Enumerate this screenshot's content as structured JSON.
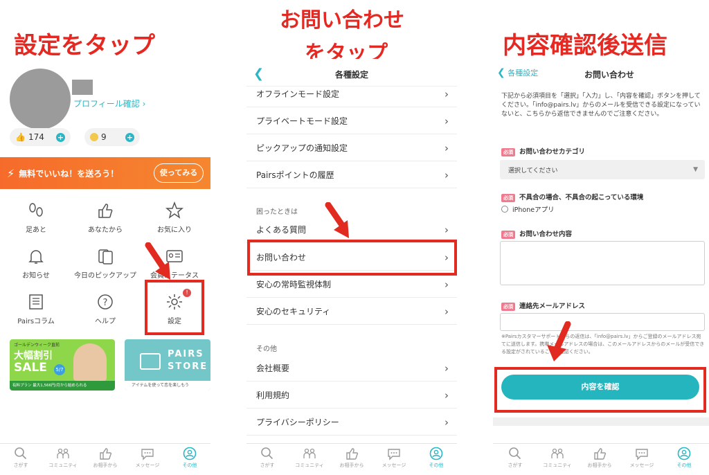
{
  "captions": {
    "step1": "設定をタップ",
    "step2_line1": "お問い合わせ",
    "step2_line2": "をタップ",
    "step3": "内容確認後送信"
  },
  "accent_color": "#29b6c5",
  "highlight_color": "#e12a20",
  "panel1": {
    "profile_link": "プロフィール確認",
    "likes_count": "174",
    "points_count": "9",
    "promo_text": "無料でいいね！を送ろう！",
    "promo_button": "使ってみる",
    "menu": [
      {
        "label": "足あと",
        "icon": "footprints-icon"
      },
      {
        "label": "あなたから",
        "icon": "like-hand-icon"
      },
      {
        "label": "お気に入り",
        "icon": "star-icon"
      },
      {
        "label": "お知らせ",
        "icon": "bell-icon"
      },
      {
        "label": "今日のピックアップ",
        "icon": "cards-icon"
      },
      {
        "label": "会員ステータス",
        "icon": "id-card-icon"
      },
      {
        "label": "Pairsコラム",
        "icon": "newspaper-icon"
      },
      {
        "label": "ヘルプ",
        "icon": "help-icon"
      },
      {
        "label": "設定",
        "icon": "gear-icon"
      }
    ],
    "settings_badge": "!",
    "banner1": {
      "tag": "ゴールデンウィーク直前",
      "title1": "大幅割引",
      "title2": "SALE",
      "date": "5/7",
      "footer": "有料プラン 最大1,566円/月から始められる"
    },
    "banner2": {
      "title1": "PAIRS",
      "title2": "STORE",
      "footer": "アイテムを使って恋を楽しもう"
    }
  },
  "tabbar": [
    {
      "label": "さがす",
      "icon": "search-icon"
    },
    {
      "label": "コミュニティ",
      "icon": "community-icon"
    },
    {
      "label": "お相手から",
      "icon": "thumbs-up-icon"
    },
    {
      "label": "メッセージ",
      "icon": "message-icon"
    },
    {
      "label": "その他",
      "icon": "person-icon"
    }
  ],
  "panel2": {
    "title": "各種設定",
    "rows_top": [
      "オフラインモード設定",
      "プライベートモード設定",
      "ピックアップの通知設定",
      "Pairsポイントの履歴"
    ],
    "section_trouble": "困ったときは",
    "rows_trouble": [
      "よくある質問",
      "お問い合わせ",
      "安心の常時監視体制",
      "安心のセキュリティ"
    ],
    "section_other": "その他",
    "rows_other": [
      "会社概要",
      "利用規約",
      "プライバシーポリシー"
    ]
  },
  "panel3": {
    "back": "各種設定",
    "title": "お問い合わせ",
    "intro": "下記から必須項目を「選択」「入力」し、「内容を確認」ボタンを押してください。「info@pairs.lv」からのメールを受信できる設定になっていないと、こちらから返信できませんのでご注意ください。",
    "required_tag": "必須",
    "category_label": "お問い合わせカテゴリ",
    "select_placeholder": "選択してください",
    "env_label": "不具合の場合、不具合の起こっている環境",
    "radio_option": "iPhoneアプリ",
    "content_label": "お問い合わせ内容",
    "email_label": "連絡先メールアドレス",
    "note": "※Pairsカスタマーサポートからの返信は、「info@pairs.lv」からご登録のメールアドレス宛てに送信します。携帯メールアドレスの場合は、このメールアドレスからのメールが受信できる設定がされていることを確認ください。",
    "confirm_button": "内容を確認"
  }
}
